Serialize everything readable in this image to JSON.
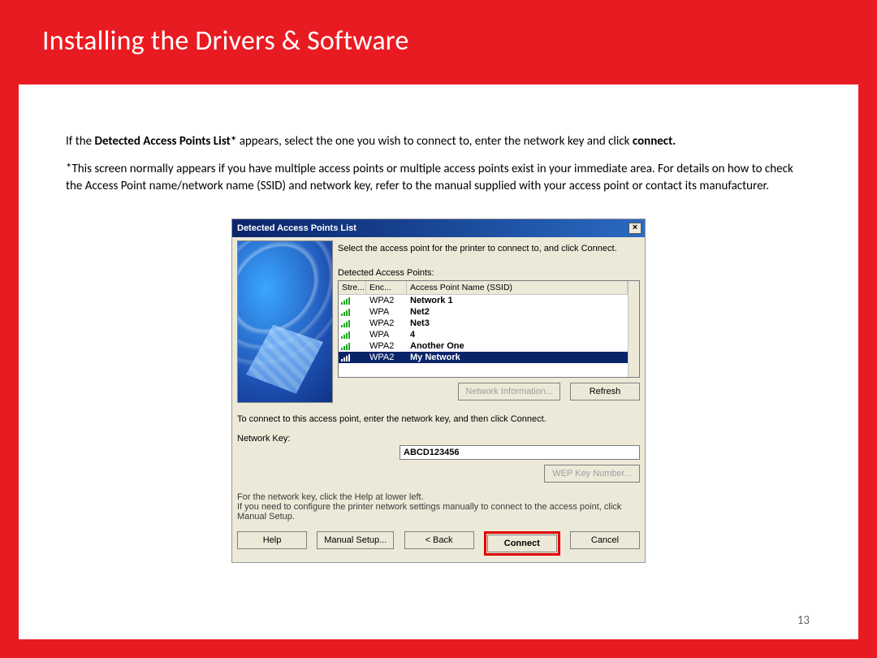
{
  "header": {
    "title": "Installing  the Drivers & Software"
  },
  "intro": {
    "p1_prefix": "If the ",
    "p1_bold": "Detected Access Points List*",
    "p1_mid": " appears,  select the one you wish to connect to, enter the network key and click ",
    "p1_bold2": "connect.",
    "p2": "*This screen normally appears if you have multiple access points or multiple access points exist in your immediate area. For details on how to check the Access Point name/network name (SSID) and network key, refer to the manual supplied with your access point or contact its manufacturer."
  },
  "dialog": {
    "title": "Detected Access Points List",
    "close": "×",
    "instruction": "Select the access point for the printer to connect to, and click Connect.",
    "detected_label": "Detected Access Points:",
    "cols": {
      "strength": "Stre...",
      "enc": "Enc...",
      "ssid": "Access Point Name (SSID)"
    },
    "rows": [
      {
        "enc": "WPA2",
        "name": "Network 1",
        "sel": false
      },
      {
        "enc": "WPA",
        "name": "Net2",
        "sel": false
      },
      {
        "enc": "WPA2",
        "name": "Net3",
        "sel": false
      },
      {
        "enc": "WPA",
        "name": "4",
        "sel": false
      },
      {
        "enc": "WPA2",
        "name": "Another One",
        "sel": false
      },
      {
        "enc": "WPA2",
        "name": "My Network",
        "sel": true
      }
    ],
    "buttons": {
      "network_info": "Network Information...",
      "refresh": "Refresh",
      "wep_key": "WEP Key Number...",
      "help": "Help",
      "manual_setup": "Manual Setup...",
      "back": "< Back",
      "connect": "Connect",
      "cancel": "Cancel"
    },
    "connect_instruction": "To connect to this access point, enter the network key, and then click Connect.",
    "network_key_label": "Network Key:",
    "network_key_value": "ABCD123456",
    "note1": "For the network key, click the Help at lower left.",
    "note2": "If you need to configure the printer network settings manually to connect to the access point, click Manual Setup."
  },
  "page_number": "13"
}
